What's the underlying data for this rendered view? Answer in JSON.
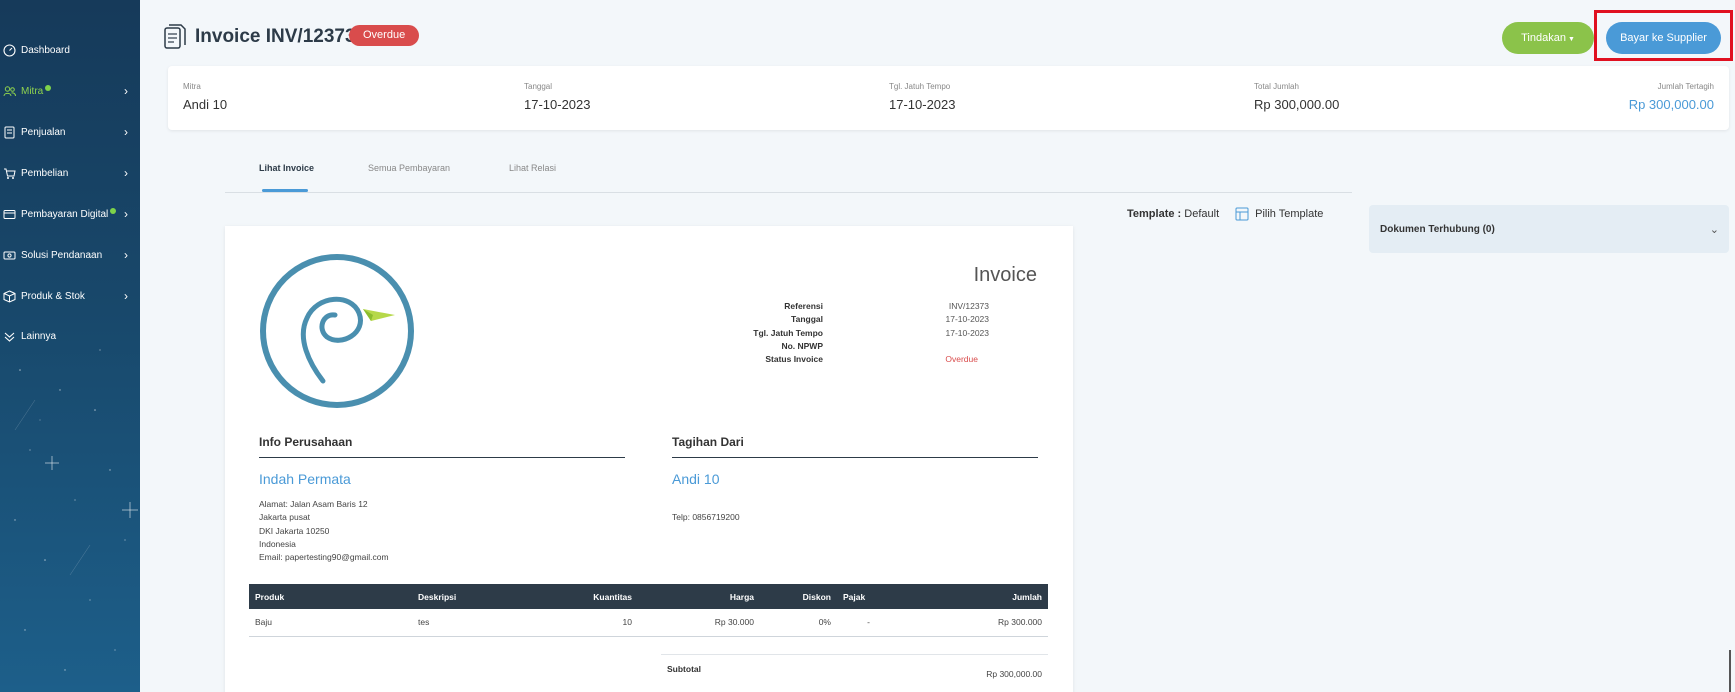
{
  "sidebar": {
    "items": [
      {
        "label": "Dashboard",
        "icon": "dashboard-icon",
        "chevron": false,
        "dot": false,
        "active": false
      },
      {
        "label": "Mitra",
        "icon": "users-icon",
        "chevron": true,
        "dot": true,
        "active": true
      },
      {
        "label": "Penjualan",
        "icon": "invoice-icon",
        "chevron": true,
        "dot": false,
        "active": false
      },
      {
        "label": "Pembelian",
        "icon": "cart-icon",
        "chevron": true,
        "dot": false,
        "active": false
      },
      {
        "label": "Pembayaran Digital",
        "icon": "card-icon",
        "chevron": true,
        "dot": true,
        "active": false
      },
      {
        "label": "Solusi Pendanaan",
        "icon": "money-icon",
        "chevron": true,
        "dot": false,
        "active": false
      },
      {
        "label": "Produk & Stok",
        "icon": "box-icon",
        "chevron": true,
        "dot": false,
        "active": false
      },
      {
        "label": "Lainnya",
        "icon": "more-icon",
        "chevron": false,
        "dot": false,
        "active": false
      }
    ],
    "chevron": "›"
  },
  "header": {
    "title": "Invoice INV/12373",
    "status_badge": "Overdue",
    "actions_label": "Tindakan",
    "pay_label": "Bayar ke Supplier"
  },
  "summary": {
    "mitra_label": "Mitra",
    "mitra_value": "Andi 10",
    "date_label": "Tanggal",
    "date_value": "17-10-2023",
    "due_label": "Tgl. Jatuh Tempo",
    "due_value": "17-10-2023",
    "total_label": "Total Jumlah",
    "total_value": "Rp 300,000.00",
    "billed_label": "Jumlah Tertagih",
    "billed_value": "Rp 300,000.00"
  },
  "tabs": [
    {
      "label": "Lihat Invoice",
      "active": true
    },
    {
      "label": "Semua Pembayaran",
      "active": false
    },
    {
      "label": "Lihat Relasi",
      "active": false
    }
  ],
  "template": {
    "label": "Template :",
    "value": "Default",
    "choose_label": "Pilih Template"
  },
  "invoice": {
    "heading": "Invoice",
    "meta": [
      {
        "label": "Referensi",
        "value": "INV/12373"
      },
      {
        "label": "Tanggal",
        "value": "17-10-2023"
      },
      {
        "label": "Tgl. Jatuh Tempo",
        "value": "17-10-2023"
      },
      {
        "label": "No. NPWP",
        "value": ""
      },
      {
        "label": "Status Invoice",
        "value": "Overdue"
      }
    ],
    "company_heading": "Info Perusahaan",
    "company_name": "Indah Permata",
    "company_address": [
      "Alamat: Jalan Asam Baris 12",
      "Jakarta pusat",
      "DKI Jakarta 10250",
      "Indonesia",
      "Email: papertesting90@gmail.com"
    ],
    "bill_heading": "Tagihan Dari",
    "bill_name": "Andi 10",
    "bill_phone": "Telp: 0856719200",
    "columns": [
      "Produk",
      "Deskripsi",
      "Kuantitas",
      "Harga",
      "Diskon",
      "Pajak",
      "Jumlah"
    ],
    "rows": [
      [
        "Baju",
        "tes",
        "10",
        "Rp 30.000",
        "0%",
        "-",
        "Rp 300.000"
      ]
    ],
    "subtotal_label": "Subtotal",
    "subtotal_value": "Rp 300,000.00"
  },
  "related_docs": {
    "label": "Dokumen Terhubung (0)"
  },
  "colors": {
    "accent": "#4a9ad7",
    "success": "#8bc34a",
    "danger": "#d94c4c",
    "sidebar": "#18486b"
  }
}
